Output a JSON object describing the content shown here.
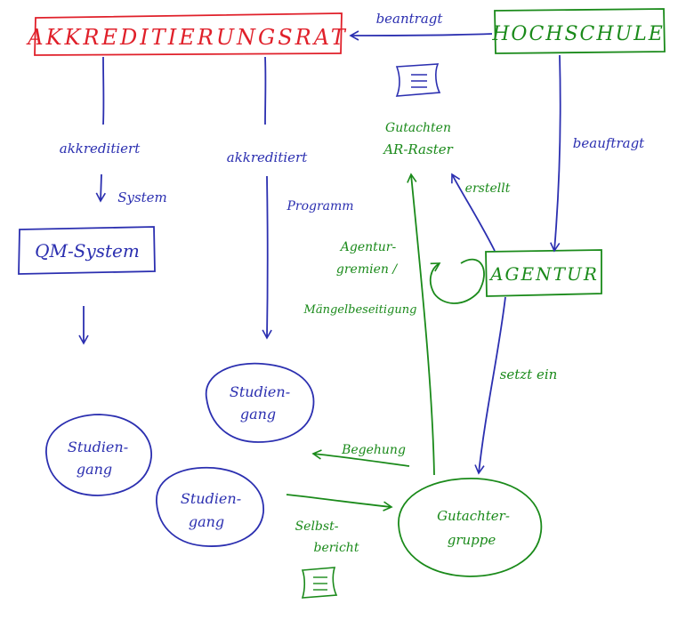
{
  "colors": {
    "red": "#e0202a",
    "blue": "#2b2fb0",
    "green": "#1a8a1a"
  },
  "nodes": {
    "akkreditierungsrat": "AKKREDITIERUNGSRAT",
    "hochschule": "HOCHSCHULE",
    "qm_system": "QM-System",
    "agentur": "AGENTUR",
    "studiengang_top_1": "Studien-",
    "studiengang_top_2": "gang",
    "studiengang_left_1": "Studien-",
    "studiengang_left_2": "gang",
    "studiengang_mid_1": "Studien-",
    "studiengang_mid_2": "gang",
    "gutachtergruppe_1": "Gutachter-",
    "gutachtergruppe_2": "gruppe"
  },
  "labels": {
    "beantragt": "beantragt",
    "beauftragt": "beauftragt",
    "akkreditiert_left": "akkreditiert",
    "system": "System",
    "akkreditiert_mid": "akkreditiert",
    "programm": "Programm",
    "gutachten_1": "Gutachten",
    "gutachten_2": "AR-Raster",
    "erstellt": "erstellt",
    "agentur_gremien_1": "Agentur-",
    "agentur_gremien_2": "gremien /",
    "maengelbeseitigung": "Mängelbeseitigung",
    "setzt_ein": "setzt ein",
    "begehung": "Begehung",
    "selbstbericht_1": "Selbst-",
    "selbstbericht_2": "bericht"
  },
  "icons": [
    "document-icon-gutachten",
    "document-icon-selbstbericht"
  ]
}
